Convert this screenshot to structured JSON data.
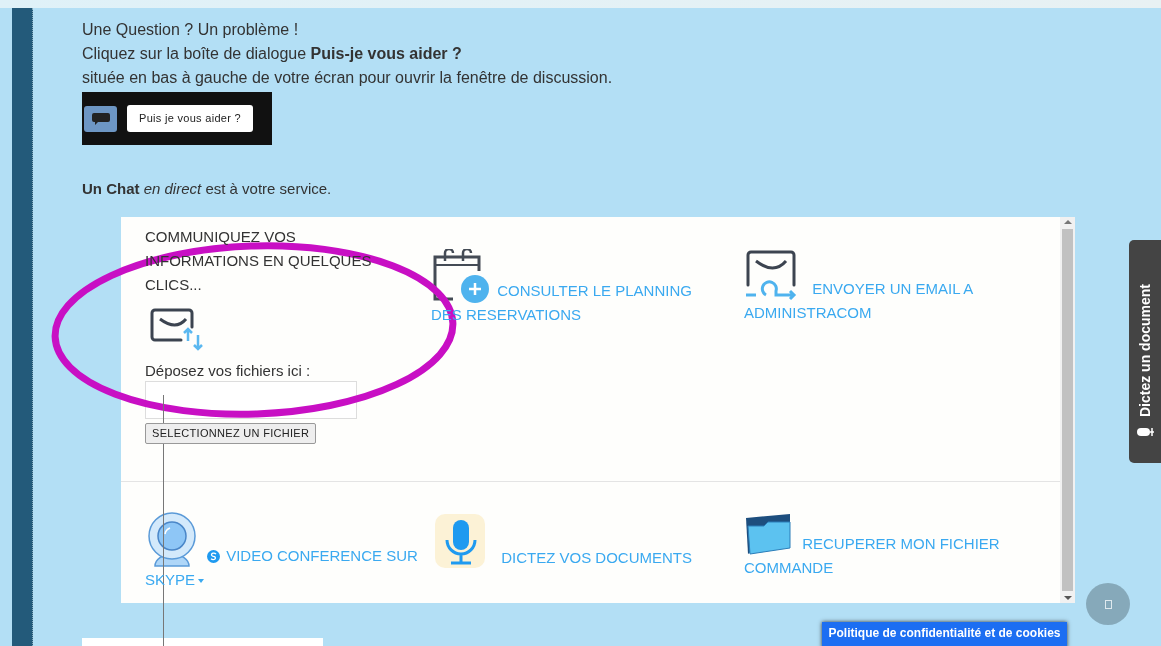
{
  "intro": {
    "lines": [
      "Une Question ? Un problème !",
      "Cliquez sur la boîte de dialogue **Puis-je vous aider ?**",
      "située en bas à gauche de votre écran pour ouvrir la fenêtre de discussion."
    ],
    "chat_preview": {
      "label": "Puis je vous aider ?"
    },
    "tagline": "**Un Chat** *en direct* est à votre service."
  },
  "card": {
    "upload": {
      "title": "COMMUNIQUEZ VOS INFORMATIONS EN QUELQUES CLICS...",
      "label": "Déposez vos fichiers ici :",
      "button": "SELECTIONNEZ UN FICHIER"
    },
    "links": [
      {
        "kind": "calendar",
        "text": "CONSULTER LE PLANNING DES RESERVATIONS"
      },
      {
        "kind": "email",
        "text": "ENVOYER UN EMAIL A ADMINISTRACOM"
      },
      {
        "kind": "webcam",
        "text": "VIDEO CONFERENCE SUR SKYPE",
        "dropdown": true
      },
      {
        "kind": "microphone",
        "text": "DICTEZ VOS DOCUMENTS"
      },
      {
        "kind": "folder",
        "text": "RECUPERER MON FICHIER COMMANDE"
      }
    ]
  },
  "side_tab": {
    "label": "Dictez un document"
  },
  "cookie_button": {
    "label": "Politique de confidentialité et de cookies"
  }
}
